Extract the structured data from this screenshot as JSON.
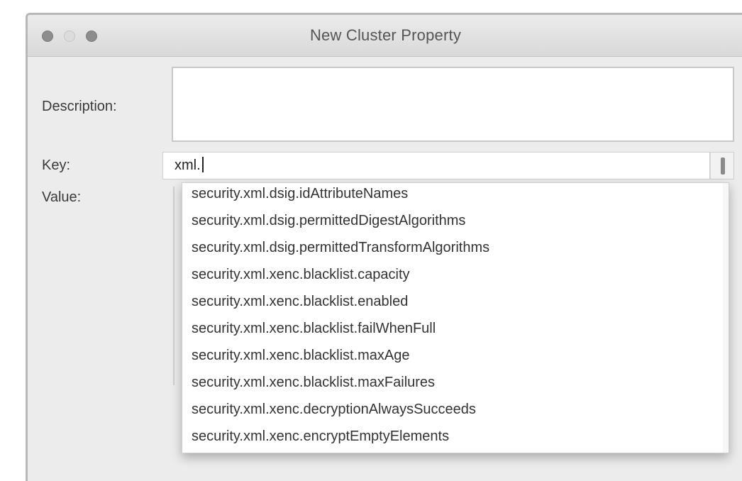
{
  "window": {
    "title": "New Cluster Property"
  },
  "form": {
    "description_label": "Description:",
    "description_value": "",
    "key_label": "Key:",
    "key_value": "xml.",
    "value_label": "Value:"
  },
  "autocomplete": {
    "items": [
      "security.xml.dsig.idAttributeNames",
      "security.xml.dsig.permittedDigestAlgorithms",
      "security.xml.dsig.permittedTransformAlgorithms",
      "security.xml.xenc.blacklist.capacity",
      "security.xml.xenc.blacklist.enabled",
      "security.xml.xenc.blacklist.failWhenFull",
      "security.xml.xenc.blacklist.maxAge",
      "security.xml.xenc.blacklist.maxFailures",
      "security.xml.xenc.decryptionAlwaysSucceeds",
      "security.xml.xenc.encryptEmptyElements"
    ]
  }
}
